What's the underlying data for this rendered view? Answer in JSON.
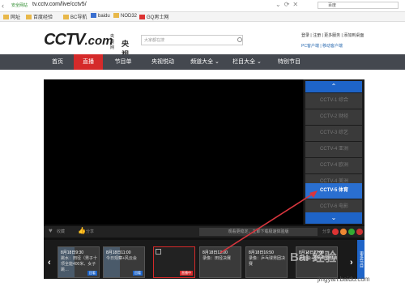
{
  "browser": {
    "secure_label": "安全网站",
    "url": "tv.cctv.com/live/cctv5/",
    "search_placeholder": "百度",
    "bookmarks": [
      "网址",
      "百度经验",
      "BC导航",
      "baidu",
      "NOD32",
      "GQ男士网"
    ]
  },
  "header": {
    "logo_text": "CCTV",
    "logo_com": ".com",
    "logo_cn_small": "央视网",
    "logo_cn": "央视",
    "search_placeholder": "大家都在搜",
    "top_links": "登录 | 注册 | 更多服务 | 添加到桌面",
    "apps": "PC客户端  |  移动客户端"
  },
  "nav": {
    "items": [
      "首页",
      "直播",
      "节目单",
      "央视悦动",
      "频道大全 ⌄",
      "栏目大全 ⌄",
      "特别节目"
    ],
    "active_index": 1
  },
  "player": {
    "channels": [
      "CCTV-1 综合",
      "CCTV-2 财经",
      "CCTV-3 综艺",
      "CCTV-4 亚洲",
      "CCTV-4 欧洲",
      "CCTV-4 美洲",
      "CCTV-5 体育",
      "CCTV-6 电影"
    ],
    "selected_channel_index": 6,
    "up_arrow": "⌃",
    "down_arrow": "⌄"
  },
  "controls": {
    "like": "收藏",
    "dislike": "分享",
    "notice": "观看更稳定，立即下载极速体验版",
    "share": "分享"
  },
  "programs": [
    {
      "time": "8月18日9:30",
      "title": "跳水：田径（男子十项全能400米、女子跳…",
      "badge": "回看",
      "kind": "normal"
    },
    {
      "time": "8月18日11:00",
      "title": "今日观察+风云会",
      "badge": "回看",
      "kind": "normal"
    },
    {
      "time": "",
      "title": "",
      "badge": "直播中",
      "kind": "live"
    },
    {
      "time": "8月18日13:00",
      "title": "录像：田径决赛",
      "badge": "",
      "kind": "noimg"
    },
    {
      "time": "8月18日16:50",
      "title": "录像：乒乓球男团决赛",
      "badge": "",
      "kind": "noimg"
    },
    {
      "time": "8月18日17:00",
      "title": "风云会+里约特别节目",
      "badge": "",
      "kind": "noimg"
    }
  ],
  "strip_side_button": "更多节目",
  "watermark": "Bai 经验",
  "watermark_url": "jingyan.baidu.com",
  "colors": {
    "nav_bg": "#44484f",
    "active_red": "#d52a2a",
    "channel_blue": "#2a6fd0",
    "annotation_red": "#d9363e"
  }
}
